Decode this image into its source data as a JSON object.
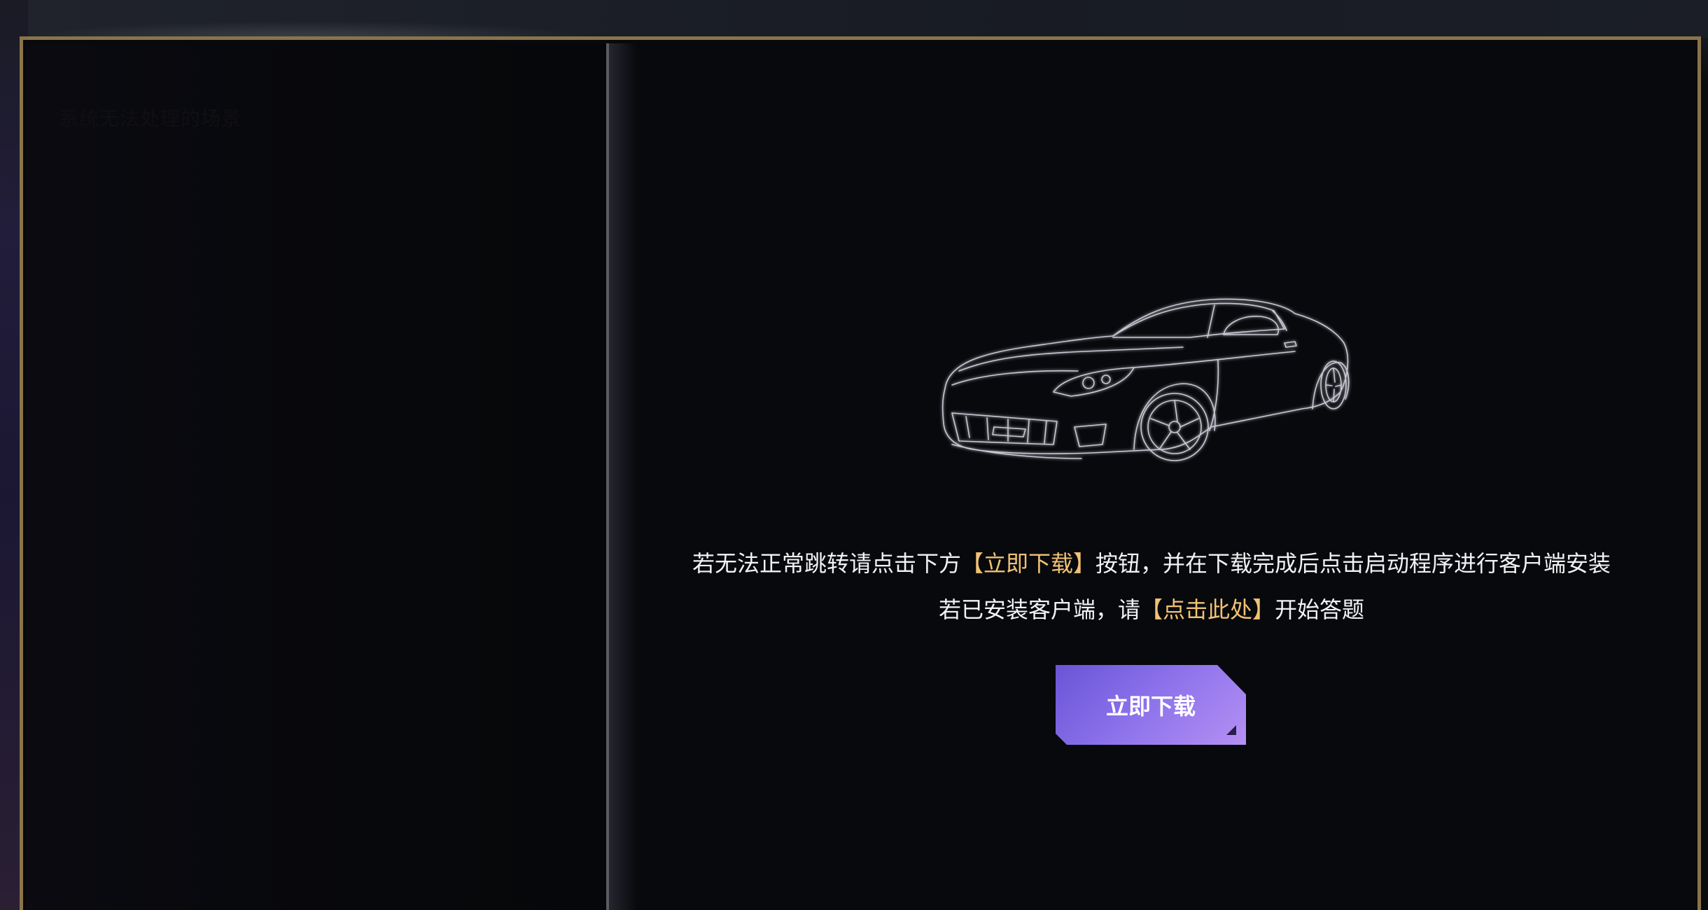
{
  "left_panel": {
    "title": "系统无法处理的场景"
  },
  "main": {
    "line1_prefix": "若无法正常跳转请点击下方",
    "line1_highlight": "【立即下载】",
    "line1_suffix": "按钮，并在下载完成后点击启动程序进行客户端安装",
    "line2_prefix": "若已安装客户端，请",
    "line2_link": "【点击此处】",
    "line2_suffix": "开始答题",
    "download_button_label": "立即下载"
  },
  "colors": {
    "frame_border": "#8a7448",
    "highlight": "#f1c274",
    "button_gradient_start": "#6a55d6",
    "button_gradient_end": "#b590f4"
  },
  "icons": {
    "illustration": "sports-car-illustration"
  }
}
